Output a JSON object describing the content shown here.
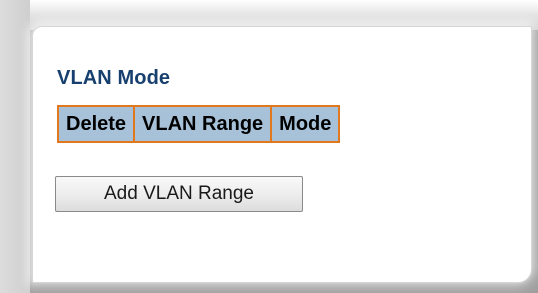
{
  "section": {
    "title": "VLAN Mode"
  },
  "table": {
    "headers": [
      "Delete",
      "VLAN Range",
      "Mode"
    ]
  },
  "actions": {
    "add_label": "Add VLAN Range"
  }
}
